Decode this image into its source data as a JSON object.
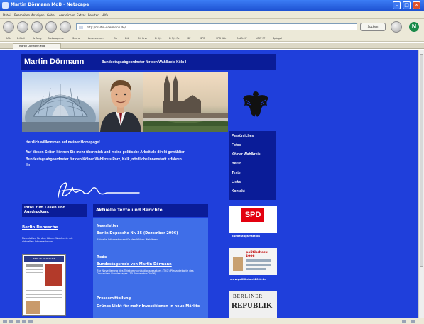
{
  "window": {
    "title": "Martin Dörmann MdB - Netscape"
  },
  "menubar": [
    "Datei",
    "Bearbeiten",
    "Anzeigen",
    "Gehe",
    "Lesezeichen",
    "Extras",
    "Fenster",
    "Hilfe"
  ],
  "navigation": {
    "url": "http://martin-doermann.de/",
    "search_button": "Suchen"
  },
  "bookmarks": [
    "AOL",
    "E-Mail",
    "Anfang",
    "Netscape.de",
    "Suche",
    "Lesezeichen",
    "Go",
    "D4",
    "D4 Kna",
    "D 3/4",
    "D 3/4 Fa",
    "SP",
    "SPD",
    "SPD Köln",
    "MdB-HP",
    "NRW LT",
    "Spiegel"
  ],
  "tab": {
    "label": "Martin Dörmann MdB"
  },
  "page": {
    "header": {
      "name": "Martin Dörmann",
      "subtitle": "Bundestagsabgeordneter für den Wahlkreis Köln I"
    },
    "welcome": {
      "heading": "Herzlich willkommen auf meiner Homepage!",
      "body": "Auf diesen Seiten können Sie mehr über mich und meine politische Arbeit als direkt gewählter Bundestagsabgeordneter für den Kölner Wahlkreis Porz, Kalk, nördliche Innenstadt erfahren.",
      "closing": "Ihr"
    },
    "nav_menu": [
      "Persönliches",
      "Fotos",
      "Kölner Wahlkreis",
      "Berlin",
      "Texte",
      "Links",
      "Kontakt"
    ],
    "left_column": {
      "header": "Infos zum Lesen und Ausdrucken:",
      "title": "Berlin Depesche",
      "description": "Newsletter für den Kölner Wahlkreis mit aktuellen Informationen.",
      "thumb_title": "BERLIN DEPESCHE"
    },
    "center_column": {
      "header": "Aktuelle Texte und Berichte",
      "items": [
        {
          "category": "Newsletter",
          "title": "Berlin Depesche Nr. 35 (Dezember 2006)",
          "description": "Aktuelle Informationen für den Kölner Wahlkreis."
        },
        {
          "category": "Rede",
          "title": "Bundestagsrede von Martin Dörmann",
          "description": "Zur Novellierung des Telekommunikationsgesetzes (TKG) Plenardebatte des Deutschen Bundestages (30. November 2006)"
        },
        {
          "category": "Pressemitteilung",
          "title": "Grünes Licht für mehr Investitionen in neue Märkte",
          "description": ""
        }
      ]
    },
    "right_column": {
      "spd_logo": "SPD",
      "spd_caption": "Bundestagsfraktion",
      "politik_logo": "politikcheck 2006",
      "politik_caption": "www.politikcheck2006.de",
      "br_line1": "BERLINER",
      "br_line2": "REPUBLIK"
    }
  },
  "colors": {
    "page_background": "#1f3fdb",
    "header_bar": "#0a1c98",
    "content_box": "#3f6ee8",
    "spd_red": "#e3000f"
  }
}
